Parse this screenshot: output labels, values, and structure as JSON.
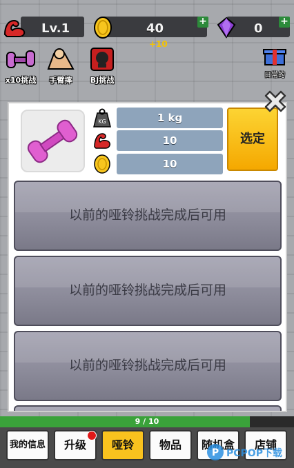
{
  "hud": {
    "level": "Lv.1",
    "coins": "40",
    "coin_bonus": "+10",
    "gems": "0",
    "plus": "+"
  },
  "quick_challenges": [
    {
      "label": "x10挑战",
      "icon": "dumbbell-icon"
    },
    {
      "label": "手臂摔",
      "icon": "arm-wrestle-icon"
    },
    {
      "label": "BJ挑战",
      "icon": "boxing-glove-icon"
    }
  ],
  "daily": {
    "label": "日常的",
    "icon": "gift-icon"
  },
  "panel": {
    "item_icon": "dumbbell-icon",
    "stats": [
      {
        "icon": "kg-weight-icon",
        "value": "1 kg"
      },
      {
        "icon": "arm-muscle-icon",
        "value": "10"
      },
      {
        "icon": "coin-icon",
        "value": "10"
      }
    ],
    "select_label": "选定",
    "locked_rows": [
      "以前的哑铃挑战完成后可用",
      "以前的哑铃挑战完成后可用",
      "以前的哑铃挑战完成后可用",
      ""
    ]
  },
  "progress": {
    "text": "9 / 10",
    "fraction": 0.85
  },
  "tabs": [
    {
      "label": "我的信息",
      "active": false
    },
    {
      "label": "升级",
      "active": false
    },
    {
      "label": "哑铃",
      "active": true
    },
    {
      "label": "物品",
      "active": false
    },
    {
      "label": "随机盒",
      "active": false
    },
    {
      "label": "店铺",
      "active": false
    }
  ],
  "watermark": {
    "text": "PCPOP下载"
  },
  "colors": {
    "accent": "#f9c21e",
    "stat_box": "#8ea4bb",
    "locked": "#8d8c9b",
    "progress": "#3aa23a"
  }
}
